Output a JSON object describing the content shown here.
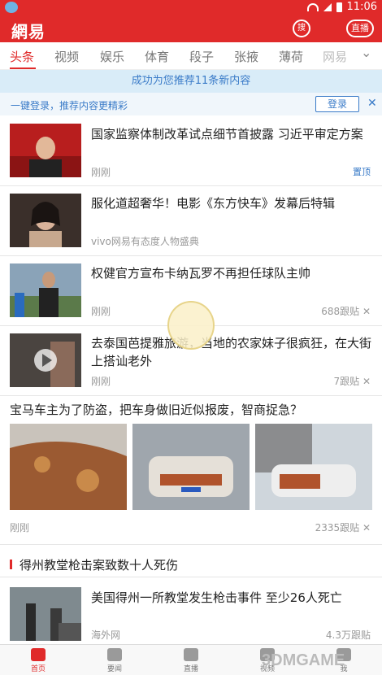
{
  "status": {
    "time": "11:06"
  },
  "header": {
    "logo": "網易",
    "search_label": "搜",
    "live_label": "直播"
  },
  "tabs": [
    "头条",
    "视频",
    "娱乐",
    "体育",
    "段子",
    "张掖",
    "薄荷",
    "网易"
  ],
  "notice": "成功为您推荐11条新内容",
  "login_bar": {
    "text": "一键登录，推荐内容更精彩",
    "button": "登录"
  },
  "news": [
    {
      "title": "国家监察体制改革试点细节首披露 习近平审定方案",
      "source": "刚刚",
      "tag": "置顶"
    },
    {
      "title": "服化道超奢华！电影《东方快车》发幕后特辑",
      "source": "vivo网易有态度人物盛典"
    },
    {
      "title": "权健官方宣布卡纳瓦罗不再担任球队主帅",
      "source": "刚刚",
      "comments": "688跟贴"
    },
    {
      "title": "去泰国芭提雅旅游，当地的农家妹子很疯狂，在大街上搭讪老外",
      "source": "刚刚",
      "comments": "7跟贴"
    }
  ],
  "photo_story": {
    "title": "宝马车主为了防盗，把车身做旧近似报废，智商捉急？",
    "source": "刚刚",
    "comments": "2335跟贴"
  },
  "section": {
    "title": "得州教堂枪击案致数十人死伤"
  },
  "news_last": {
    "title": "美国得州一所教堂发生枪击事件 至少26人死亡",
    "source": "海外网",
    "comments": "4.3万跟贴"
  },
  "bottom_nav": [
    "首页",
    "要闻",
    "直播",
    "视频",
    "我"
  ],
  "watermark": "3DMGAME",
  "colors": {
    "brand": "#e02a2a",
    "link": "#3a7bc8"
  }
}
